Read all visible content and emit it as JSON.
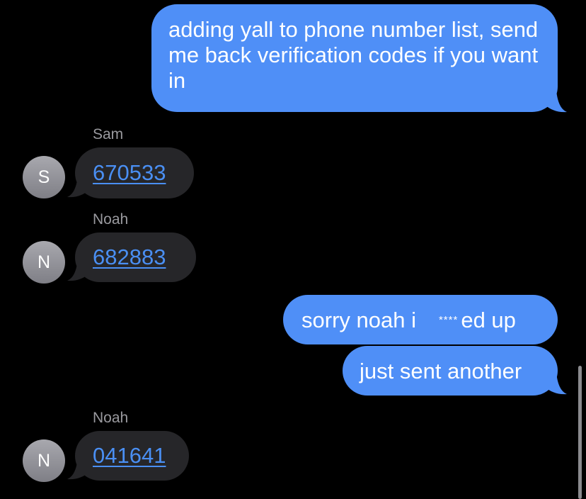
{
  "messages": {
    "m1_out": {
      "text": "adding yall to phone number list, send me back verification codes if you want in"
    },
    "m2_in": {
      "sender": "Sam",
      "avatar_initial": "S",
      "code": "670533"
    },
    "m3_in": {
      "sender": "Noah",
      "avatar_initial": "N",
      "code": "682883"
    },
    "m4_out": {
      "text_before": "sorry noah i",
      "censor": "****",
      "text_after": "ed up"
    },
    "m5_out": {
      "text": "just sent another"
    },
    "m6_in": {
      "sender": "Noah",
      "avatar_initial": "N",
      "code": "041641"
    }
  },
  "colors": {
    "background": "#000000",
    "outgoing_bubble": "#4f8ff7",
    "incoming_bubble": "#262629",
    "link": "#4a8ff3",
    "sender_label": "#9a9a9f",
    "avatar": "#8e8e93"
  }
}
